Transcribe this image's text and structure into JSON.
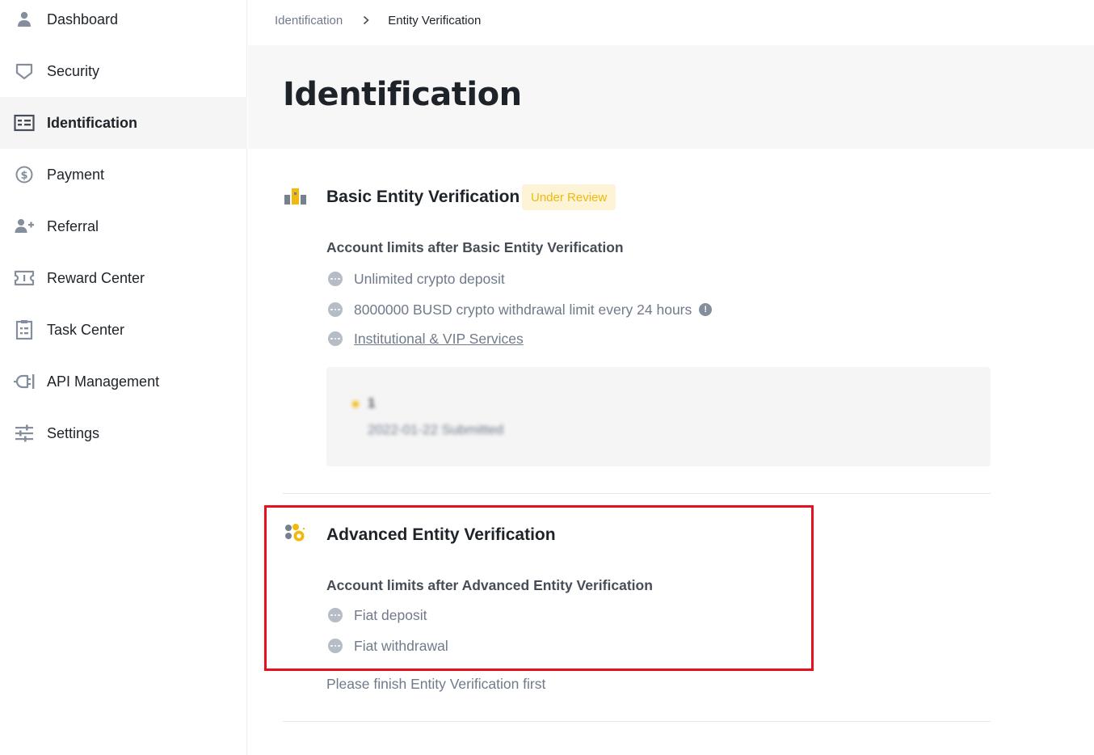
{
  "sidebar": {
    "items": [
      {
        "label": "Dashboard",
        "icon": "user-icon"
      },
      {
        "label": "Security",
        "icon": "shield-icon"
      },
      {
        "label": "Identification",
        "icon": "id-card-icon",
        "active": true
      },
      {
        "label": "Payment",
        "icon": "dollar-circle-icon"
      },
      {
        "label": "Referral",
        "icon": "add-user-icon"
      },
      {
        "label": "Reward Center",
        "icon": "ticket-icon"
      },
      {
        "label": "Task Center",
        "icon": "checklist-icon"
      },
      {
        "label": "API Management",
        "icon": "plug-icon"
      },
      {
        "label": "Settings",
        "icon": "sliders-icon"
      }
    ]
  },
  "breadcrumb": {
    "parent": "Identification",
    "current": "Entity Verification"
  },
  "page": {
    "title": "Identification"
  },
  "basic": {
    "title": "Basic Entity Verification",
    "status_badge": "Under Review",
    "limits_heading": "Account limits after Basic Entity Verification",
    "limits": [
      "Unlimited crypto deposit",
      "8000000 BUSD crypto withdrawal limit every 24 hours",
      "Institutional & VIP Services"
    ],
    "submission": {
      "level": "1",
      "date_status": "2022-01-22 Submitted"
    }
  },
  "advanced": {
    "title": "Advanced Entity Verification",
    "limits_heading": "Account limits after Advanced Entity Verification",
    "limits": [
      "Fiat deposit",
      "Fiat withdrawal"
    ],
    "note": "Please finish Entity Verification first"
  },
  "colors": {
    "accent": "#F0B90B",
    "badge_bg": "#FDF3D6",
    "highlight_border": "#E8101C",
    "text_primary": "#1E2329",
    "text_secondary": "#707A8A"
  }
}
